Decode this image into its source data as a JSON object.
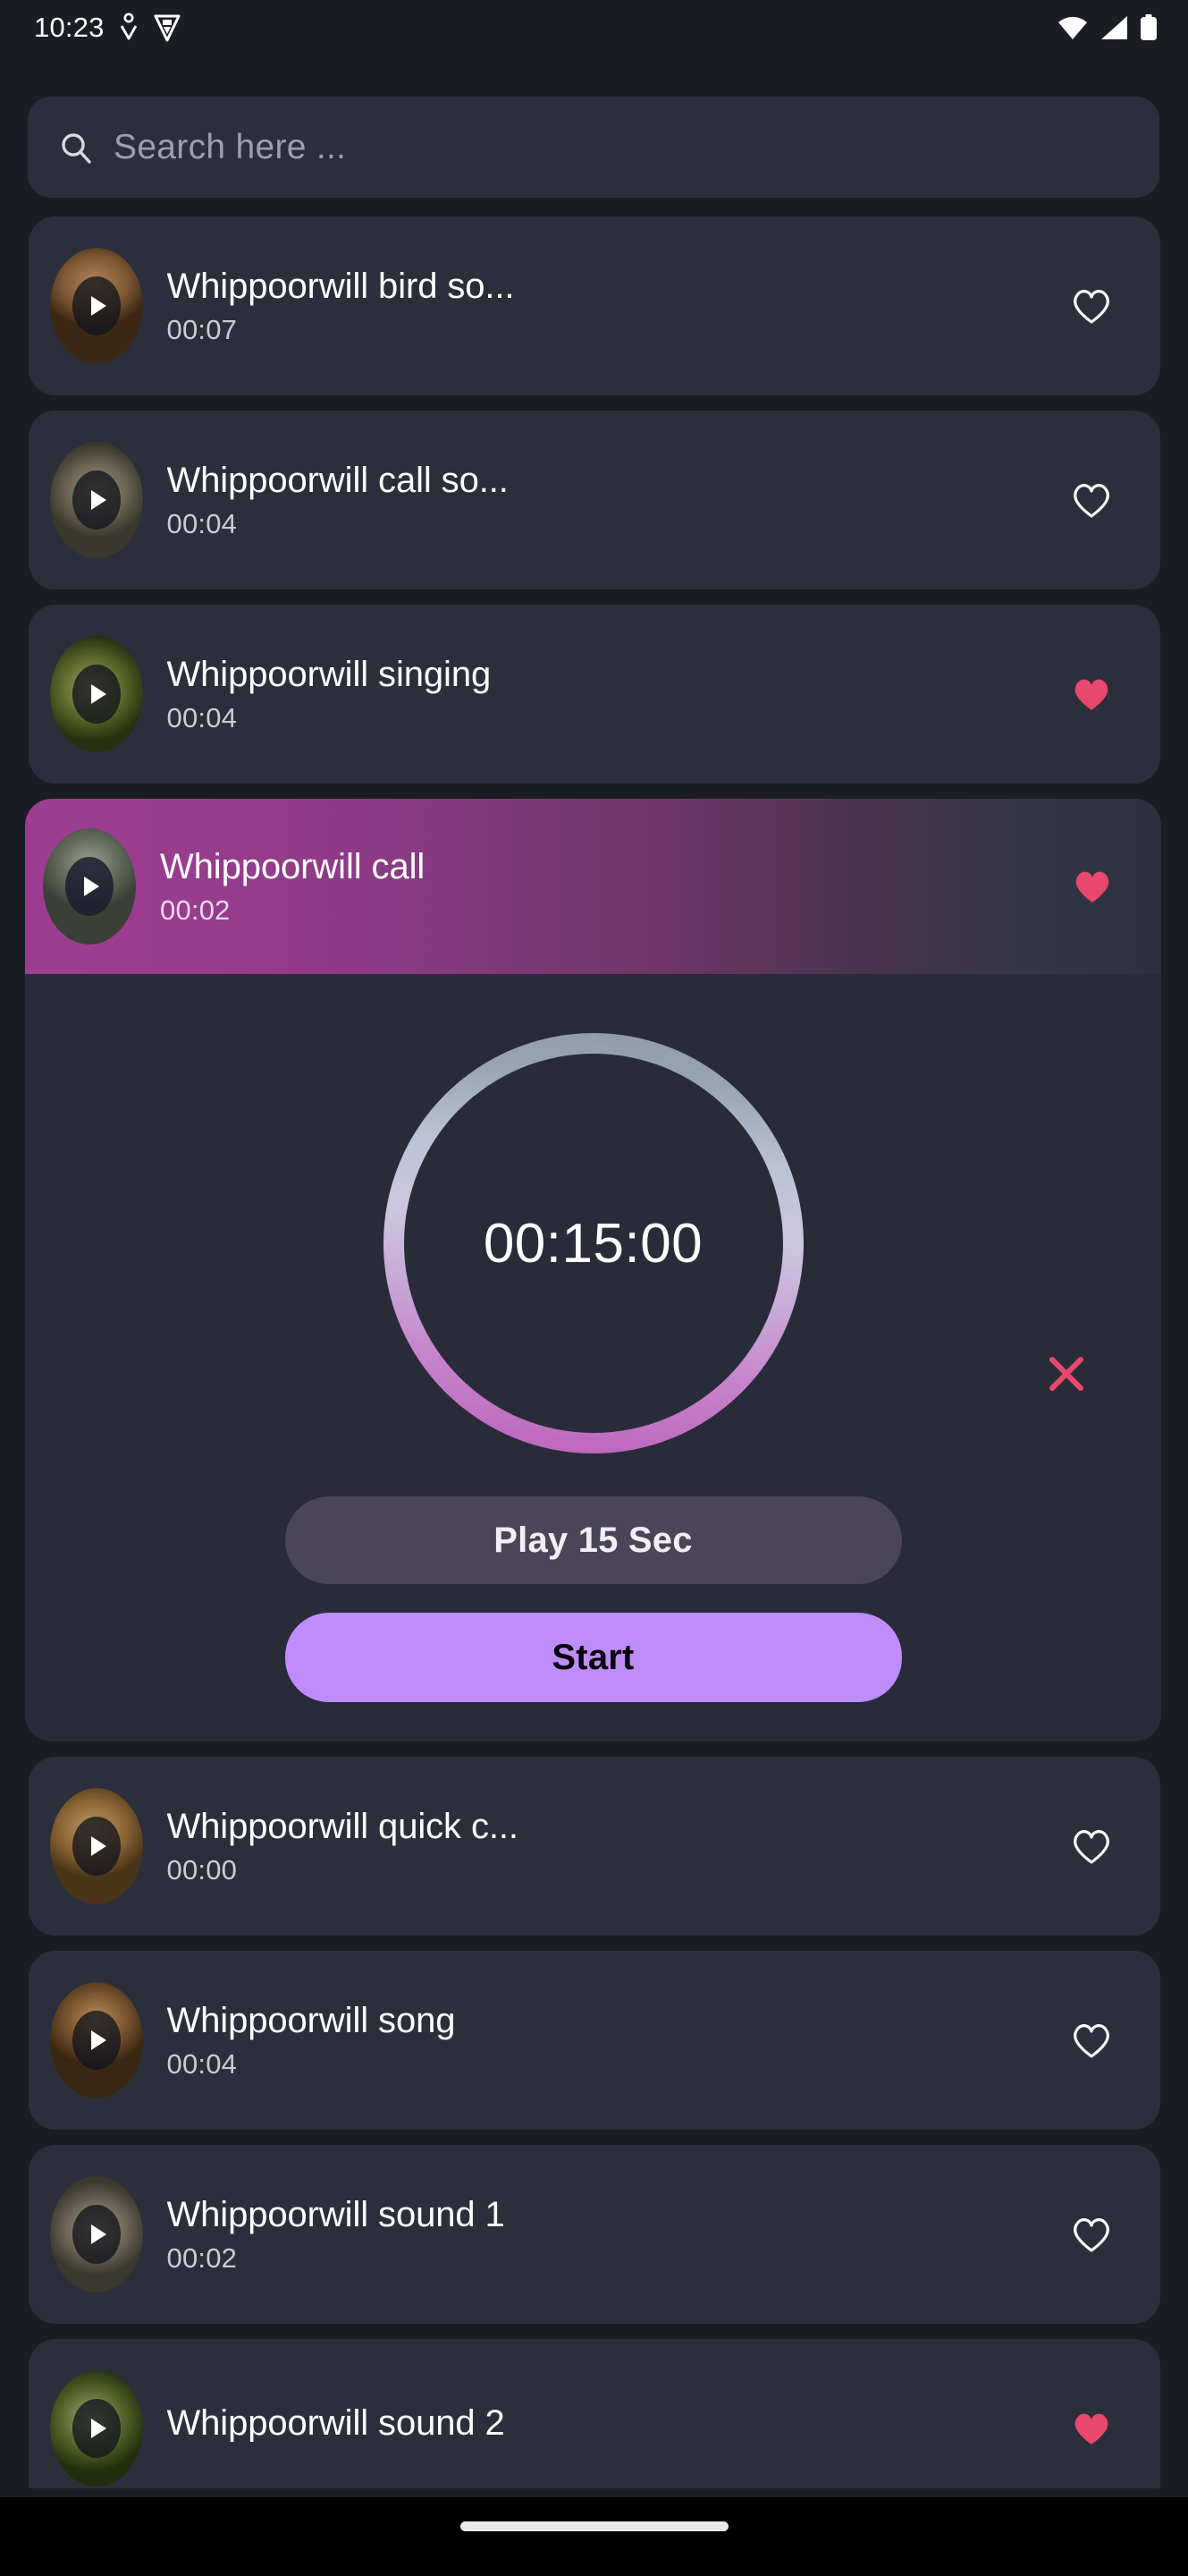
{
  "status_bar": {
    "clock": "10:23",
    "left_icons": [
      "person-pin-icon",
      "shield-icon"
    ],
    "right_icons": [
      "wifi-icon",
      "cellular-signal-icon",
      "battery-icon"
    ]
  },
  "search": {
    "placeholder": "Search here ...",
    "value": "",
    "icon": "search-icon"
  },
  "colors": {
    "page_bg": "#1b1d24",
    "card_bg": "#2b2f3b",
    "panel_bg": "#292c38",
    "accent_purple": "#bf8cfb",
    "accent_magenta": "#9c3d91",
    "heart_filled": "#e8486b",
    "close_red": "#e8486b",
    "play_button_bg": "#4a4658"
  },
  "sounds": [
    {
      "title": "Whippoorwill bird so...",
      "duration": "00:07",
      "favorite": false,
      "active": false,
      "thumb": "thumb-whippoorwill-1"
    },
    {
      "title": "Whippoorwill call so...",
      "duration": "00:04",
      "favorite": false,
      "active": false,
      "thumb": "thumb-whippoorwill-2"
    },
    {
      "title": "Whippoorwill singing",
      "duration": "00:04",
      "favorite": true,
      "active": false,
      "thumb": "thumb-whippoorwill-3"
    },
    {
      "title": "Whippoorwill call",
      "duration": "00:02",
      "favorite": true,
      "active": true,
      "thumb": "thumb-whippoorwill-4"
    }
  ],
  "sounds_after_timer": [
    {
      "title": "Whippoorwill quick c...",
      "duration": "00:00",
      "favorite": false,
      "active": false,
      "thumb": "thumb-whippoorwill-5"
    },
    {
      "title": "Whippoorwill song",
      "duration": "00:04",
      "favorite": false,
      "active": false,
      "thumb": "thumb-whippoorwill-6"
    },
    {
      "title": "Whippoorwill sound 1",
      "duration": "00:02",
      "favorite": false,
      "active": false,
      "thumb": "thumb-whippoorwill-7"
    },
    {
      "title": "Whippoorwill sound 2",
      "duration": "",
      "favorite": true,
      "active": false,
      "thumb": "thumb-whippoorwill-8"
    }
  ],
  "timer": {
    "display": "00:15:00",
    "close_label": "close-timer-icon",
    "play_button_label": "Play 15 Sec",
    "start_button_label": "Start"
  },
  "system_nav": {
    "home_indicator": "home-indicator"
  }
}
